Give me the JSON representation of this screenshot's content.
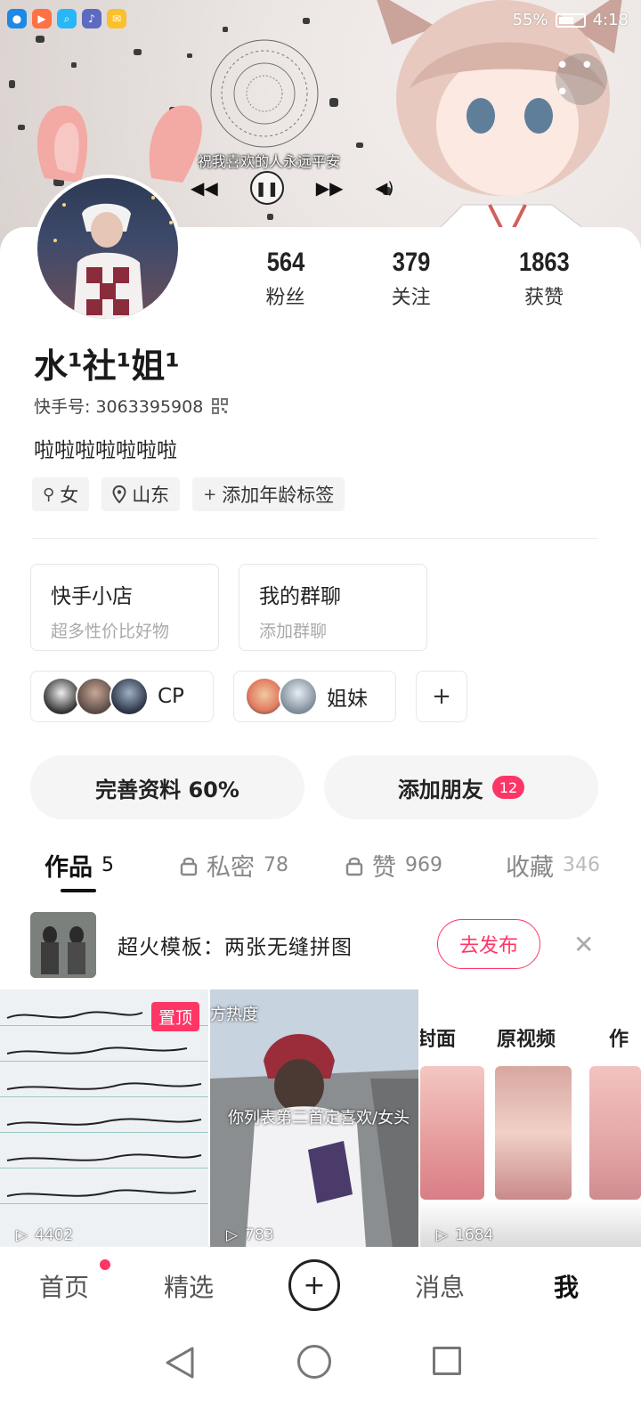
{
  "status": {
    "battery": "55%",
    "time": "4:18"
  },
  "music": {
    "title": "祝我喜欢的人永远平安"
  },
  "profile": {
    "stats": [
      {
        "value": "564",
        "label": "粉丝"
      },
      {
        "value": "379",
        "label": "关注"
      },
      {
        "value": "1863",
        "label": "获赞"
      }
    ],
    "nickname": "水¹社¹姐¹",
    "kuaishou_id_label": "快手号: 3063395908",
    "bio": "啦啦啦啦啦啦啦",
    "tags": {
      "gender": "女",
      "location": "山东",
      "age": "添加年龄标签"
    }
  },
  "features": [
    {
      "title": "快手小店",
      "subtitle": "超多性价比好物"
    },
    {
      "title": "我的群聊",
      "subtitle": "添加群聊"
    }
  ],
  "groups": [
    {
      "label": "CP"
    },
    {
      "label": "姐妹"
    }
  ],
  "actions": {
    "complete_profile": "完善资料 60%",
    "add_friends": "添加朋友",
    "add_friends_badge": "12"
  },
  "tabs": [
    {
      "label": "作品",
      "count": "5"
    },
    {
      "label": "私密",
      "count": "78"
    },
    {
      "label": "赞",
      "count": "969"
    },
    {
      "label": "收藏",
      "count": "346"
    }
  ],
  "promo": {
    "text": "超火模板：两张无缝拼图",
    "button": "去发布"
  },
  "videos": [
    {
      "pinned_label": "置顶",
      "plays": "4402"
    },
    {
      "caption": "你列表第二首定喜欢/女头",
      "corner": "方热度",
      "plays": "783"
    },
    {
      "label_a": "封面",
      "label_b": "原视频",
      "label_c": "作",
      "plays": "1684"
    }
  ],
  "bottom_nav": {
    "home": "首页",
    "featured": "精选",
    "messages": "消息",
    "me": "我"
  },
  "colors": {
    "accent": "#fe3666"
  }
}
